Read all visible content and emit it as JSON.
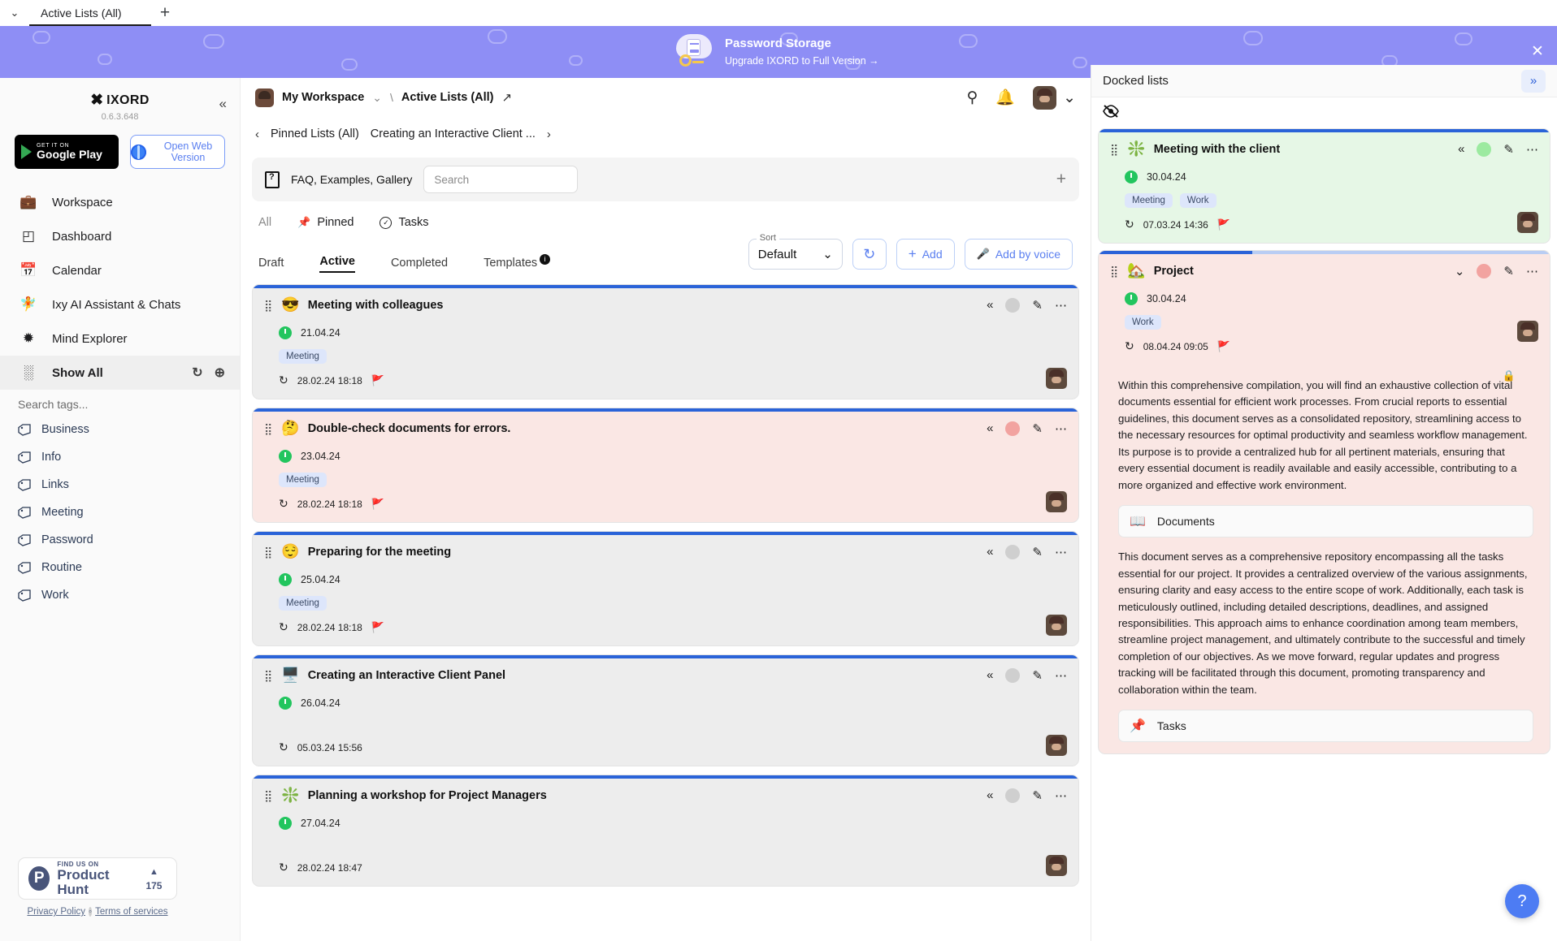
{
  "browser": {
    "tab_title": "Active Lists (All)",
    "new_tab_label": "+",
    "chevron": "⌄"
  },
  "promo": {
    "title": "Password Storage",
    "subtitle": "Upgrade IXORD to Full Version  →",
    "close": "✕"
  },
  "sidebar": {
    "brand_logo": "✖",
    "brand_name": "IXORD",
    "version": "0.6.3.648",
    "collapse_icon": "«",
    "google_play": {
      "small": "GET IT ON",
      "big": "Google Play"
    },
    "web_version": "Open Web Version",
    "nav": [
      {
        "label": "Workspace",
        "icon": "💼"
      },
      {
        "label": "Dashboard",
        "icon": "◰"
      },
      {
        "label": "Calendar",
        "icon": "📅"
      },
      {
        "label": "Ixy AI Assistant & Chats",
        "icon": "🧚"
      },
      {
        "label": "Mind Explorer",
        "icon": "✹"
      }
    ],
    "show_all": {
      "label": "Show All",
      "icon": "░",
      "refresh": "↻",
      "add": "⊕"
    },
    "search_tags_placeholder": "Search tags...",
    "tags": [
      "Business",
      "Info",
      "Links",
      "Meeting",
      "Password",
      "Routine",
      "Work"
    ],
    "product_hunt": {
      "small": "FIND US ON",
      "big": "Product Hunt",
      "triangle": "▲",
      "votes": "175"
    },
    "legal": {
      "privacy": "Privacy Policy",
      "dot": "◦",
      "terms": "Terms of services"
    }
  },
  "main": {
    "workspace_name": "My Workspace",
    "workspace_chevron": "⌄",
    "breadcrumb_sep": "\\",
    "breadcrumb_current": "Active Lists (All)",
    "open_external_icon": "↗",
    "header_icons": {
      "search": "⚲",
      "bell": "🔔",
      "avatar_chevron": "⌄"
    },
    "pinned_prev": "‹",
    "pinned_label": "Pinned Lists (All)",
    "pinned_current": "Creating an Interactive Client ...",
    "pinned_next": "›",
    "faq_label": "FAQ, Examples, Gallery",
    "search_placeholder": "Search",
    "faq_plus": "+",
    "filters": [
      {
        "label": "All",
        "icon": "",
        "active": true
      },
      {
        "label": "Pinned",
        "icon": "📌",
        "active": false
      },
      {
        "label": "Tasks",
        "icon": "✓",
        "active": false
      }
    ],
    "tabs": [
      {
        "label": "Draft",
        "selected": false
      },
      {
        "label": "Active",
        "selected": true
      },
      {
        "label": "Completed",
        "selected": false
      },
      {
        "label": "Templates",
        "selected": false,
        "info": "i"
      }
    ],
    "sort": {
      "label": "Sort",
      "value": "Default",
      "chevron": "⌄"
    },
    "refresh_icon": "↻",
    "add_label": "Add",
    "add_plus": "+",
    "add_voice_label": "Add by voice",
    "voice_icon": "🎤",
    "cards": [
      {
        "emoji": "😎",
        "title": "Meeting with colleagues",
        "date": "21.04.24",
        "chips": [
          "Meeting"
        ],
        "updated": "28.02.24 18:18",
        "flag": "🚩",
        "flag_color": "#22c55e",
        "bg": "#ededed",
        "dot_color": "#cfcfcf",
        "progress": 100,
        "collapse_icon": "«"
      },
      {
        "emoji": "🤔",
        "title": "Double-check documents for errors.",
        "date": "23.04.24",
        "chips": [
          "Meeting"
        ],
        "updated": "28.02.24 18:18",
        "flag": "🚩",
        "flag_color": "#ef4444",
        "bg": "#fae7e4",
        "dot_color": "#f2a3a0",
        "progress": 100,
        "collapse_icon": "«"
      },
      {
        "emoji": "😌",
        "title": "Preparing for the meeting",
        "date": "25.04.24",
        "chips": [
          "Meeting"
        ],
        "updated": "28.02.24 18:18",
        "flag": "🚩",
        "flag_color": "#ef4444",
        "bg": "#ededed",
        "dot_color": "#cfcfcf",
        "progress": 100,
        "collapse_icon": "«"
      },
      {
        "emoji": "🖥️",
        "title": "Creating an Interactive Client Panel",
        "date": "26.04.24",
        "chips": [],
        "updated": "05.03.24 15:56",
        "flag": "",
        "flag_color": "",
        "bg": "#ededed",
        "dot_color": "#cfcfcf",
        "progress": 100,
        "collapse_icon": "«"
      },
      {
        "emoji": "❇️",
        "title": "Planning a workshop for Project Managers",
        "date": "27.04.24",
        "chips": [],
        "updated": "28.02.24 18:47",
        "flag": "",
        "flag_color": "",
        "bg": "#ededed",
        "dot_color": "#cfcfcf",
        "progress": 100,
        "collapse_icon": "«"
      }
    ]
  },
  "docked": {
    "title": "Docked lists",
    "expand_icon": "»",
    "hide_icon": "👁",
    "cards": [
      {
        "emoji": "❇️",
        "title": "Meeting with the client",
        "date": "30.04.24",
        "chips": [
          "Meeting",
          "Work"
        ],
        "updated": "07.03.24 14:36",
        "flag": "🚩",
        "flag_color": "#eab308",
        "bg": "#e6f7e6",
        "dot_color": "#9ceaa0",
        "progress": 100,
        "collapse_icon": "«"
      },
      {
        "emoji": "🏡",
        "title": "Project",
        "date": "30.04.24",
        "chips": [
          "Work"
        ],
        "updated": "08.04.24 09:05",
        "flag": "🚩",
        "flag_color": "#ef4444",
        "bg": "#fae7e4",
        "dot_color": "#f2a3a0",
        "progress": 34,
        "collapse_icon": "⌄",
        "lock_icon": "🔒",
        "paragraph_1": "Within this comprehensive compilation, you will find an exhaustive collection of vital documents essential for efficient work processes. From crucial reports to essential guidelines, this document serves as a consolidated repository, streamlining access to the necessary resources for optimal productivity and seamless workflow management. Its purpose is to provide a centralized hub for all pertinent materials, ensuring that every essential document is readily available and easily accessible, contributing to a more organized and effective work environment.",
        "block_documents": {
          "icon": "📖",
          "label": "Documents"
        },
        "paragraph_2": "This document serves as a comprehensive repository encompassing all the tasks essential for our project. It provides a centralized overview of the various assignments, ensuring clarity and easy access to the entire scope of work. Additionally, each task is meticulously outlined, including detailed descriptions, deadlines, and assigned responsibilities. This approach aims to enhance coordination among team members, streamline project management, and ultimately contribute to the successful and timely completion of our objectives. As we move forward, regular updates and progress tracking will be facilitated through this document, promoting transparency and collaboration within the team.",
        "block_tasks": {
          "icon": "📌",
          "label": "Tasks"
        }
      }
    ],
    "help_button": "?"
  }
}
